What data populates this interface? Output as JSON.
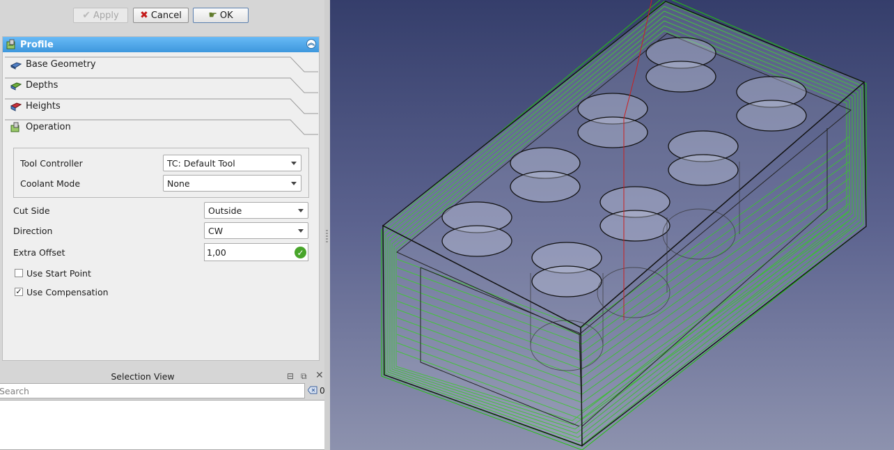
{
  "dialog_buttons": {
    "apply": "Apply",
    "cancel": "Cancel",
    "ok": "OK"
  },
  "panel": {
    "title": "Profile",
    "tabs": [
      {
        "label": "Base Geometry",
        "icon": "base-geometry-icon"
      },
      {
        "label": "Depths",
        "icon": "depths-icon"
      },
      {
        "label": "Heights",
        "icon": "heights-icon"
      },
      {
        "label": "Operation",
        "icon": "operation-icon"
      }
    ],
    "operation": {
      "tool_controller_label": "Tool Controller",
      "tool_controller_value": "TC: Default Tool",
      "coolant_label": "Coolant Mode",
      "coolant_value": "None",
      "cut_side_label": "Cut Side",
      "cut_side_value": "Outside",
      "direction_label": "Direction",
      "direction_value": "CW",
      "extra_offset_label": "Extra Offset",
      "extra_offset_value": "1,00",
      "use_start_point_label": "Use Start Point",
      "use_start_point_checked": false,
      "use_compensation_label": "Use Compensation",
      "use_compensation_checked": true
    }
  },
  "selection_view": {
    "title": "Selection View",
    "search_placeholder": "Search",
    "count": "0"
  },
  "colors": {
    "header_blue": "#3d97dd",
    "toolpath_green": "#22c40f",
    "toolpath_red": "#cc1f1f",
    "viewport_top": "#353e6b",
    "viewport_bottom": "#8d92ae"
  }
}
